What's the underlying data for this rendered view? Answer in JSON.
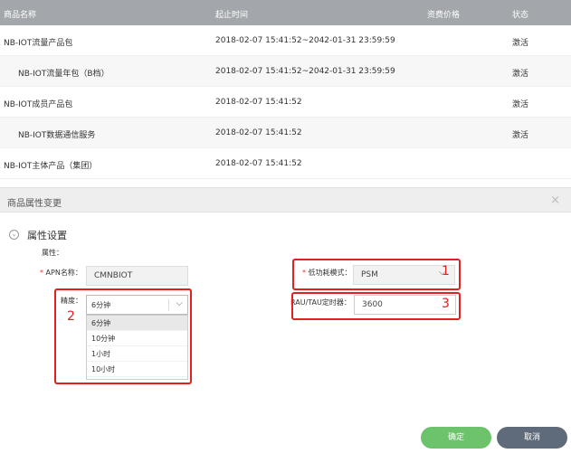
{
  "table": {
    "headers": [
      "商品名称",
      "起止时间",
      "资费价格",
      "状态"
    ],
    "rows": [
      {
        "name": "NB-IOT流量产品包",
        "time": "2018-02-07 15:41:52~2042-01-31 23:59:59",
        "price": "",
        "status": "激活"
      },
      {
        "name": "NB-IOT流量年包（B档）",
        "time": "2018-02-07 15:41:52~2042-01-31 23:59:59",
        "price": "",
        "status": "激活"
      },
      {
        "name": "NB-IOT成员产品包",
        "time": "2018-02-07 15:41:52",
        "price": "",
        "status": "激活"
      },
      {
        "name": "NB-IOT数据通信服务",
        "time": "2018-02-07 15:41:52",
        "price": "",
        "status": "激活"
      },
      {
        "name": "NB-IOT主体产品（集团）",
        "time": "2018-02-07 15:41:52",
        "price": "",
        "status": ""
      }
    ]
  },
  "panel": {
    "title": "商品属性变更",
    "close_icon": "×",
    "section_title": "属性设置",
    "attr_label": "属性：",
    "apn": {
      "required": "*",
      "label": "APN名称：",
      "value": "CMNBIOT"
    },
    "precision": {
      "label": "精度：",
      "value": "6分钟",
      "options": [
        "6分钟",
        "10分钟",
        "1小时",
        "10小时"
      ]
    },
    "psm": {
      "required": "*",
      "label": "低功耗模式：",
      "value": "PSM"
    },
    "rau": {
      "label": "RAU/TAU定时器：",
      "value": "3600"
    }
  },
  "annotations": {
    "n1": "1",
    "n2": "2",
    "n3": "3",
    "color": "#e12020"
  },
  "buttons": {
    "ok": "确定",
    "cancel": "取消"
  }
}
